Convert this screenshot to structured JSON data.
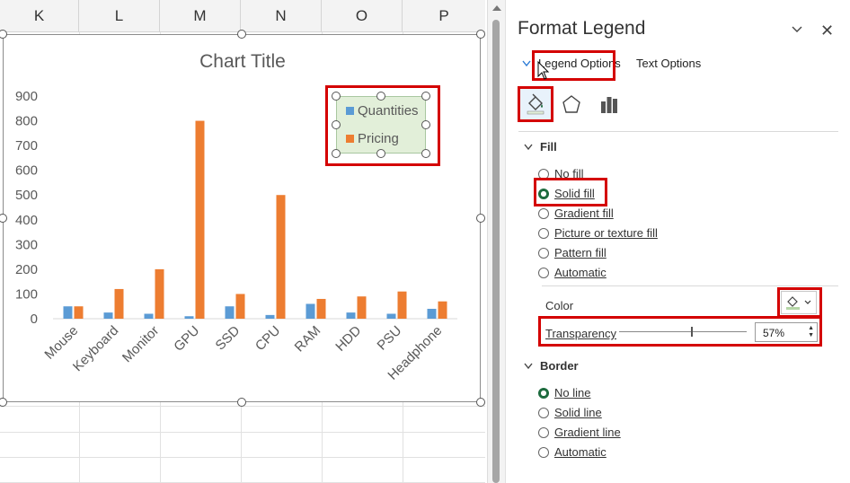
{
  "sheet": {
    "columns": [
      "K",
      "L",
      "M",
      "N",
      "O",
      "P"
    ]
  },
  "chart": {
    "title": "Chart Title",
    "chart_data": {
      "type": "bar",
      "title": "Chart Title",
      "categories": [
        "Mouse",
        "Keyboard",
        "Monitor",
        "GPU",
        "SSD",
        "CPU",
        "RAM",
        "HDD",
        "PSU",
        "Headphone"
      ],
      "series": [
        {
          "name": "Quantities",
          "values": [
            50,
            25,
            20,
            10,
            50,
            15,
            60,
            25,
            20,
            40
          ],
          "color": "#5b9bd5"
        },
        {
          "name": "Pricing",
          "values": [
            50,
            120,
            200,
            800,
            100,
            500,
            80,
            90,
            110,
            70
          ],
          "color": "#ed7d31"
        }
      ],
      "ylim": [
        0,
        900
      ],
      "yticks": [
        "900",
        "800",
        "700",
        "600",
        "500",
        "400",
        "300",
        "200",
        "100",
        "0"
      ],
      "legend_position": "top-right",
      "grid": false
    },
    "legend_fill": "#e2efd9"
  },
  "pane": {
    "title": "Format Legend",
    "tabs": {
      "legend_options": "Legend Options",
      "text_options": "Text Options"
    },
    "icons": [
      "fill-line-icon",
      "effects-icon",
      "legend-options-icon"
    ],
    "fill": {
      "heading": "Fill",
      "options": [
        {
          "label": "No fill",
          "selected": false
        },
        {
          "label": "Solid fill",
          "selected": true
        },
        {
          "label": "Gradient fill",
          "selected": false
        },
        {
          "label": "Picture or texture fill",
          "selected": false
        },
        {
          "label": "Pattern fill",
          "selected": false
        },
        {
          "label": "Automatic",
          "selected": false
        }
      ],
      "color_label": "Color",
      "transparency_label": "Transparency",
      "transparency_value": "57%",
      "transparency_fraction": 0.57
    },
    "border": {
      "heading": "Border",
      "options": [
        {
          "label": "No line",
          "selected": true
        },
        {
          "label": "Solid line",
          "selected": false
        },
        {
          "label": "Gradient line",
          "selected": false
        },
        {
          "label": "Automatic",
          "selected": false
        }
      ]
    }
  },
  "accent": "#d40000",
  "selected_radio_color": "#1d6b3e"
}
